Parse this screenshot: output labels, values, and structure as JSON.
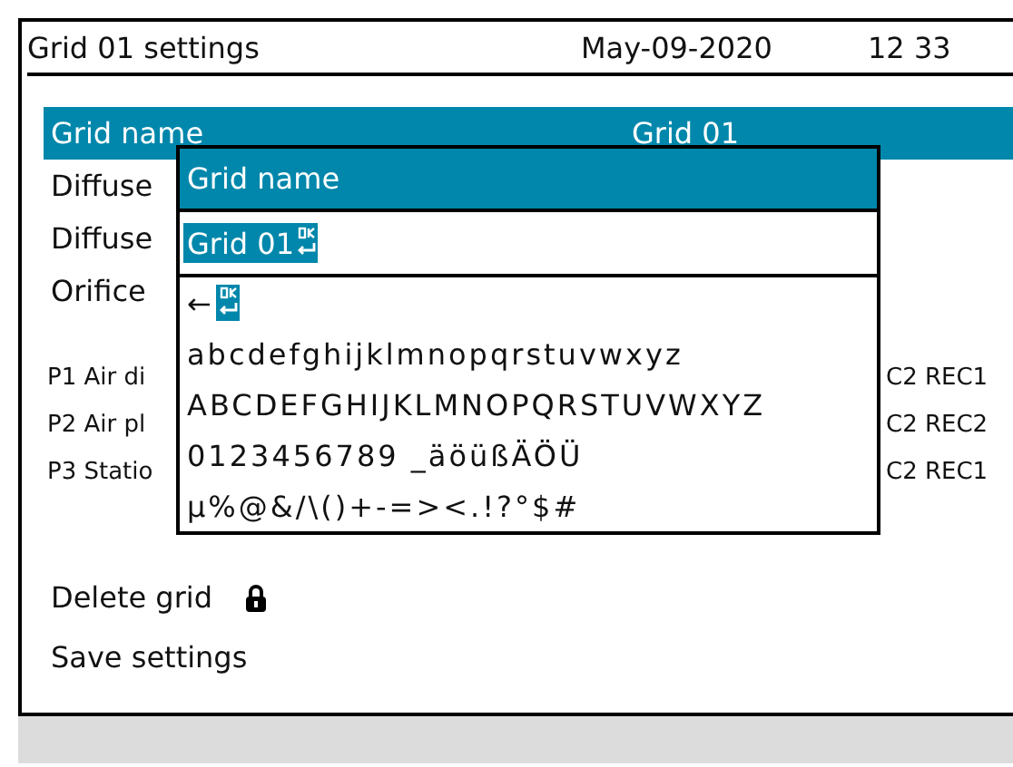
{
  "header": {
    "title": "Grid 01 settings",
    "date": "May-09-2020",
    "time": "12 33"
  },
  "settings": [
    {
      "label": "Grid name",
      "value": "Grid 01",
      "selected": true
    },
    {
      "label": "Diffuse",
      "selected": false
    },
    {
      "label": "Diffuse",
      "selected": false
    },
    {
      "label": "Orifice",
      "selected": false
    }
  ],
  "points": [
    {
      "label": "P1 Air di",
      "value": "C2 REC1"
    },
    {
      "label": "P2 Air pl",
      "value": "C2 REC2"
    },
    {
      "label": "P3 Statio",
      "value": "C2 REC1"
    }
  ],
  "actions": [
    {
      "label": "Delete grid",
      "locked": true
    },
    {
      "label": "Save settings",
      "locked": false
    }
  ],
  "dialog": {
    "title": "Grid name",
    "value": "Grid 01",
    "value_selected": true,
    "rows": [
      {
        "kind": "controls",
        "text": "←"
      },
      {
        "kind": "chars",
        "text": "abcdefghijklmnopqrstuvwxyz"
      },
      {
        "kind": "chars",
        "text": "ABCDEFGHIJKLMNOPQRSTUVWXYZ"
      },
      {
        "kind": "chars",
        "text": "0123456789 _äöüßÄÖÜ"
      },
      {
        "kind": "chars",
        "text": "µ%@&/\\()+-=><.!?°$#"
      }
    ]
  }
}
